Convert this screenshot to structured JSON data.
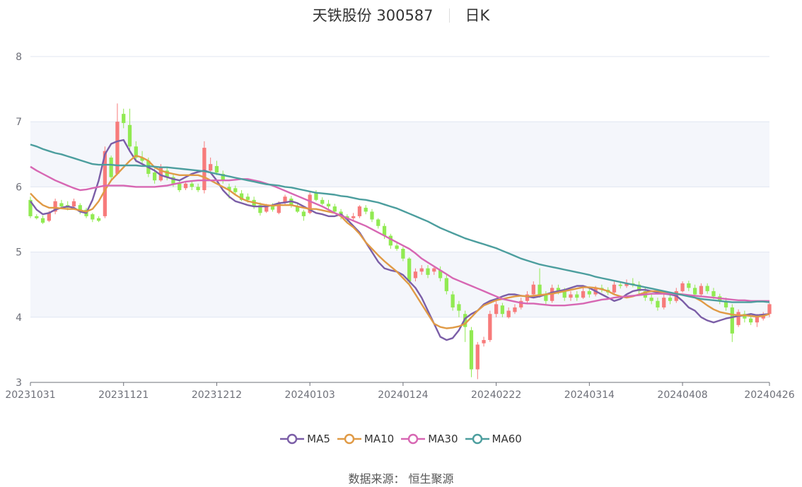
{
  "header": {
    "title": "天铁股份 300587",
    "period": "日K"
  },
  "footer": {
    "source_label": "数据来源：",
    "source_name": "恒生聚源"
  },
  "colors": {
    "up": "#f77b7b",
    "down": "#91ea52",
    "ma5": "#7b5ea7",
    "ma10": "#e09a45",
    "ma30": "#d767b3",
    "ma60": "#4c9e9e",
    "band": "#f4f6fb",
    "grid": "#e0e6f1"
  },
  "chart_data": {
    "type": "candlestick",
    "ylim": [
      3,
      8
    ],
    "yticks": [
      3,
      4,
      5,
      6,
      7,
      8
    ],
    "xtick_labels": [
      "20231031",
      "20231121",
      "20231212",
      "20240103",
      "20240124",
      "20240222",
      "20240314",
      "20240408",
      "20240426"
    ],
    "xtick_index": [
      0,
      15,
      30,
      45,
      60,
      75,
      90,
      105,
      119
    ],
    "grid": true,
    "legend_position": "bottom-center",
    "candles": [
      [
        5.8,
        5.55,
        5.85,
        5.52
      ],
      [
        5.55,
        5.52,
        5.58,
        5.5
      ],
      [
        5.52,
        5.45,
        5.56,
        5.43
      ],
      [
        5.48,
        5.6,
        5.63,
        5.46
      ],
      [
        5.62,
        5.78,
        5.82,
        5.58
      ],
      [
        5.75,
        5.7,
        5.8,
        5.66
      ],
      [
        5.72,
        5.68,
        5.78,
        5.64
      ],
      [
        5.7,
        5.78,
        5.82,
        5.67
      ],
      [
        5.72,
        5.62,
        5.75,
        5.58
      ],
      [
        5.65,
        5.55,
        5.68,
        5.52
      ],
      [
        5.58,
        5.5,
        5.6,
        5.46
      ],
      [
        5.52,
        5.48,
        5.55,
        5.46
      ],
      [
        5.55,
        6.55,
        6.62,
        5.52
      ],
      [
        6.45,
        6.15,
        6.48,
        6.1
      ],
      [
        6.2,
        7.0,
        7.28,
        6.18
      ],
      [
        7.12,
        6.98,
        7.2,
        6.9
      ],
      [
        6.95,
        6.62,
        7.2,
        6.55
      ],
      [
        6.62,
        6.45,
        6.7,
        6.38
      ],
      [
        6.45,
        6.4,
        6.55,
        6.35
      ],
      [
        6.4,
        6.2,
        6.45,
        6.15
      ],
      [
        6.22,
        6.1,
        6.28,
        6.05
      ],
      [
        6.1,
        6.3,
        6.35,
        6.08
      ],
      [
        6.25,
        6.15,
        6.3,
        6.1
      ],
      [
        6.15,
        6.05,
        6.2,
        6.0
      ],
      [
        6.05,
        5.95,
        6.1,
        5.92
      ],
      [
        5.98,
        6.05,
        6.08,
        5.95
      ],
      [
        6.05,
        6.0,
        6.1,
        5.95
      ],
      [
        6.0,
        5.95,
        6.05,
        5.92
      ],
      [
        5.95,
        6.6,
        6.7,
        5.9
      ],
      [
        6.25,
        6.35,
        6.45,
        6.2
      ],
      [
        6.32,
        6.22,
        6.4,
        6.18
      ],
      [
        6.2,
        6.1,
        6.25,
        6.05
      ],
      [
        6.0,
        5.95,
        6.05,
        5.82
      ],
      [
        5.98,
        5.92,
        6.02,
        5.88
      ],
      [
        5.9,
        5.8,
        5.95,
        5.78
      ],
      [
        5.85,
        5.8,
        5.9,
        5.76
      ],
      [
        5.8,
        5.7,
        5.85,
        5.66
      ],
      [
        5.72,
        5.6,
        5.76,
        5.56
      ],
      [
        5.62,
        5.7,
        5.74,
        5.6
      ],
      [
        5.7,
        5.65,
        5.75,
        5.62
      ],
      [
        5.6,
        5.75,
        5.78,
        5.58
      ],
      [
        5.75,
        5.85,
        5.88,
        5.72
      ],
      [
        5.82,
        5.72,
        5.86,
        5.68
      ],
      [
        5.7,
        5.62,
        5.74,
        5.6
      ],
      [
        5.62,
        5.55,
        5.65,
        5.48
      ],
      [
        5.6,
        5.88,
        5.92,
        5.58
      ],
      [
        5.9,
        5.8,
        5.95,
        5.78
      ],
      [
        5.8,
        5.74,
        5.84,
        5.72
      ],
      [
        5.74,
        5.7,
        5.8,
        5.66
      ],
      [
        5.7,
        5.62,
        5.74,
        5.6
      ],
      [
        5.62,
        5.55,
        5.66,
        5.5
      ],
      [
        5.55,
        5.5,
        5.58,
        5.44
      ],
      [
        5.52,
        5.55,
        5.6,
        5.48
      ],
      [
        5.55,
        5.7,
        5.72,
        5.52
      ],
      [
        5.68,
        5.62,
        5.72,
        5.58
      ],
      [
        5.62,
        5.5,
        5.66,
        5.46
      ],
      [
        5.5,
        5.4,
        5.52,
        5.36
      ],
      [
        5.4,
        5.25,
        5.44,
        5.2
      ],
      [
        5.25,
        5.1,
        5.28,
        5.05
      ],
      [
        5.1,
        5.05,
        5.14,
        5.02
      ],
      [
        5.05,
        4.9,
        5.08,
        4.86
      ],
      [
        4.9,
        4.55,
        4.92,
        4.5
      ],
      [
        4.6,
        4.7,
        4.75,
        4.55
      ],
      [
        4.7,
        4.75,
        4.8,
        4.65
      ],
      [
        4.75,
        4.65,
        4.8,
        4.6
      ],
      [
        4.7,
        4.75,
        4.78,
        4.65
      ],
      [
        4.72,
        4.6,
        4.78,
        4.55
      ],
      [
        4.6,
        4.4,
        4.65,
        4.35
      ],
      [
        4.35,
        4.15,
        4.4,
        4.1
      ],
      [
        4.2,
        4.1,
        4.25,
        4.0
      ],
      [
        4.05,
        3.85,
        4.1,
        3.62
      ],
      [
        3.8,
        3.2,
        3.85,
        3.08
      ],
      [
        3.2,
        3.58,
        3.62,
        3.05
      ],
      [
        3.6,
        3.65,
        3.7,
        3.55
      ],
      [
        3.65,
        4.05,
        4.1,
        3.62
      ],
      [
        4.05,
        4.2,
        4.25,
        4.0
      ],
      [
        4.18,
        4.05,
        4.22,
        4.0
      ],
      [
        4.0,
        4.1,
        4.15,
        3.98
      ],
      [
        4.08,
        4.15,
        4.2,
        4.05
      ],
      [
        4.15,
        4.25,
        4.3,
        4.12
      ],
      [
        4.25,
        4.35,
        4.4,
        4.2
      ],
      [
        4.35,
        4.5,
        4.55,
        4.3
      ],
      [
        4.5,
        4.35,
        4.75,
        4.3
      ],
      [
        4.35,
        4.25,
        4.4,
        4.2
      ],
      [
        4.25,
        4.45,
        4.5,
        4.22
      ],
      [
        4.45,
        4.4,
        4.5,
        4.35
      ],
      [
        4.4,
        4.3,
        4.45,
        4.25
      ],
      [
        4.3,
        4.35,
        4.4,
        4.25
      ],
      [
        4.35,
        4.3,
        4.4,
        4.25
      ],
      [
        4.3,
        4.4,
        4.45,
        4.28
      ],
      [
        4.4,
        4.35,
        4.45,
        4.3
      ],
      [
        4.35,
        4.45,
        4.48,
        4.32
      ],
      [
        4.45,
        4.42,
        4.5,
        4.38
      ],
      [
        4.42,
        4.38,
        4.46,
        4.34
      ],
      [
        4.38,
        4.5,
        4.55,
        4.36
      ],
      [
        4.5,
        4.48,
        4.55,
        4.44
      ],
      [
        4.48,
        4.52,
        4.58,
        4.45
      ],
      [
        4.52,
        4.5,
        4.6,
        4.46
      ],
      [
        4.5,
        4.4,
        4.55,
        4.36
      ],
      [
        4.4,
        4.3,
        4.45,
        4.25
      ],
      [
        4.3,
        4.25,
        4.35,
        4.2
      ],
      [
        4.25,
        4.15,
        4.3,
        4.1
      ],
      [
        4.15,
        4.3,
        4.35,
        4.12
      ],
      [
        4.3,
        4.25,
        4.35,
        4.2
      ],
      [
        4.25,
        4.4,
        4.45,
        4.22
      ],
      [
        4.4,
        4.52,
        4.55,
        4.38
      ],
      [
        4.52,
        4.45,
        4.56,
        4.4
      ],
      [
        4.45,
        4.35,
        4.5,
        4.3
      ],
      [
        4.35,
        4.48,
        4.52,
        4.32
      ],
      [
        4.48,
        4.4,
        4.52,
        4.36
      ],
      [
        4.4,
        4.32,
        4.45,
        4.28
      ],
      [
        4.32,
        4.25,
        4.36,
        4.2
      ],
      [
        4.25,
        4.15,
        4.3,
        4.1
      ],
      [
        4.15,
        3.75,
        4.2,
        3.62
      ],
      [
        3.88,
        4.08,
        4.12,
        3.85
      ],
      [
        4.05,
        3.98,
        4.1,
        3.92
      ],
      [
        3.98,
        3.92,
        4.02,
        3.88
      ],
      [
        3.92,
        4.0,
        4.05,
        3.85
      ],
      [
        3.98,
        4.05,
        4.08,
        3.95
      ],
      [
        4.05,
        4.2,
        4.22,
        4.0
      ]
    ],
    "series": [
      {
        "name": "MA5",
        "values": [
          5.78,
          5.65,
          5.58,
          5.6,
          5.65,
          5.68,
          5.7,
          5.68,
          5.62,
          5.6,
          5.8,
          6.1,
          6.5,
          6.66,
          6.7,
          6.72,
          6.55,
          6.4,
          6.35,
          6.3,
          6.25,
          6.18,
          6.15,
          6.12,
          6.1,
          6.15,
          6.2,
          6.23,
          6.25,
          6.22,
          6.1,
          5.95,
          5.85,
          5.78,
          5.75,
          5.72,
          5.7,
          5.7,
          5.7,
          5.72,
          5.75,
          5.76,
          5.78,
          5.75,
          5.7,
          5.65,
          5.6,
          5.58,
          5.55,
          5.55,
          5.58,
          5.5,
          5.4,
          5.3,
          5.15,
          5.0,
          4.85,
          4.75,
          4.72,
          4.7,
          4.65,
          4.55,
          4.45,
          4.3,
          4.1,
          3.9,
          3.7,
          3.65,
          3.68,
          3.8,
          3.98,
          4.05,
          4.1,
          4.2,
          4.25,
          4.28,
          4.32,
          4.35,
          4.35,
          4.33,
          4.32,
          4.3,
          4.32,
          4.35,
          4.38,
          4.4,
          4.42,
          4.45,
          4.48,
          4.48,
          4.45,
          4.4,
          4.35,
          4.3,
          4.25,
          4.28,
          4.35,
          4.4,
          4.42,
          4.42,
          4.4,
          4.38,
          4.36,
          4.35,
          4.33,
          4.25,
          4.15,
          4.1,
          4.0,
          3.95,
          3.92,
          3.95,
          3.98,
          4.0,
          4.02,
          4.03,
          4.05,
          4.03,
          4.04,
          4.05
        ]
      },
      {
        "name": "MA10",
        "values": [
          5.9,
          5.8,
          5.72,
          5.68,
          5.68,
          5.67,
          5.66,
          5.66,
          5.64,
          5.62,
          5.66,
          5.78,
          5.95,
          6.1,
          6.2,
          6.3,
          6.4,
          6.48,
          6.45,
          6.4,
          6.3,
          6.25,
          6.22,
          6.2,
          6.18,
          6.18,
          6.18,
          6.18,
          6.15,
          6.1,
          6.05,
          6.0,
          5.95,
          5.88,
          5.82,
          5.78,
          5.76,
          5.74,
          5.72,
          5.71,
          5.72,
          5.72,
          5.72,
          5.7,
          5.68,
          5.66,
          5.66,
          5.64,
          5.62,
          5.6,
          5.55,
          5.45,
          5.38,
          5.28,
          5.15,
          5.05,
          4.95,
          4.86,
          4.78,
          4.7,
          4.6,
          4.5,
          4.35,
          4.2,
          4.05,
          3.9,
          3.85,
          3.83,
          3.84,
          3.86,
          3.9,
          4.0,
          4.1,
          4.18,
          4.22,
          4.26,
          4.28,
          4.3,
          4.32,
          4.33,
          4.32,
          4.33,
          4.34,
          4.35,
          4.36,
          4.38,
          4.4,
          4.42,
          4.44,
          4.46,
          4.46,
          4.45,
          4.43,
          4.4,
          4.35,
          4.32,
          4.3,
          4.32,
          4.35,
          4.38,
          4.4,
          4.4,
          4.38,
          4.37,
          4.36,
          4.35,
          4.33,
          4.3,
          4.25,
          4.18,
          4.12,
          4.08,
          4.06,
          4.04,
          4.03,
          4.03,
          4.02,
          4.01,
          4.02,
          4.05
        ]
      },
      {
        "name": "MA30",
        "values": [
          6.31,
          6.25,
          6.2,
          6.15,
          6.1,
          6.06,
          6.02,
          5.98,
          5.95,
          5.96,
          5.98,
          6.0,
          6.02,
          6.02,
          6.02,
          6.02,
          6.01,
          6.0,
          6.0,
          6.0,
          6.0,
          6.01,
          6.02,
          6.04,
          6.06,
          6.08,
          6.09,
          6.1,
          6.1,
          6.1,
          6.1,
          6.1,
          6.1,
          6.11,
          6.12,
          6.12,
          6.1,
          6.08,
          6.05,
          6.02,
          5.98,
          5.94,
          5.9,
          5.86,
          5.82,
          5.78,
          5.74,
          5.7,
          5.65,
          5.6,
          5.56,
          5.52,
          5.48,
          5.44,
          5.4,
          5.35,
          5.3,
          5.25,
          5.2,
          5.15,
          5.1,
          5.05,
          4.98,
          4.9,
          4.84,
          4.78,
          4.72,
          4.66,
          4.6,
          4.56,
          4.52,
          4.48,
          4.44,
          4.4,
          4.36,
          4.32,
          4.28,
          4.26,
          4.24,
          4.22,
          4.21,
          4.21,
          4.2,
          4.19,
          4.18,
          4.18,
          4.18,
          4.19,
          4.2,
          4.21,
          4.23,
          4.25,
          4.27,
          4.28,
          4.3,
          4.31,
          4.32,
          4.33,
          4.34,
          4.35,
          4.36,
          4.36,
          4.36,
          4.36,
          4.35,
          4.35,
          4.34,
          4.33,
          4.32,
          4.31,
          4.3,
          4.29,
          4.28,
          4.27,
          4.26,
          4.26,
          4.25,
          4.25,
          4.25,
          4.25
        ]
      },
      {
        "name": "MA60",
        "values": [
          6.65,
          6.62,
          6.58,
          6.55,
          6.52,
          6.5,
          6.47,
          6.44,
          6.41,
          6.38,
          6.35,
          6.34,
          6.34,
          6.34,
          6.33,
          6.33,
          6.33,
          6.33,
          6.32,
          6.32,
          6.31,
          6.3,
          6.3,
          6.29,
          6.28,
          6.27,
          6.26,
          6.25,
          6.24,
          6.22,
          6.2,
          6.18,
          6.16,
          6.14,
          6.12,
          6.1,
          6.08,
          6.06,
          6.04,
          6.03,
          6.02,
          6.0,
          5.99,
          5.97,
          5.95,
          5.93,
          5.91,
          5.9,
          5.89,
          5.88,
          5.86,
          5.85,
          5.83,
          5.81,
          5.8,
          5.78,
          5.76,
          5.73,
          5.7,
          5.67,
          5.63,
          5.59,
          5.55,
          5.51,
          5.47,
          5.42,
          5.37,
          5.33,
          5.29,
          5.25,
          5.21,
          5.18,
          5.15,
          5.12,
          5.09,
          5.06,
          5.02,
          4.98,
          4.94,
          4.9,
          4.87,
          4.84,
          4.81,
          4.79,
          4.77,
          4.75,
          4.73,
          4.71,
          4.69,
          4.67,
          4.65,
          4.62,
          4.6,
          4.58,
          4.56,
          4.54,
          4.52,
          4.5,
          4.48,
          4.46,
          4.44,
          4.42,
          4.4,
          4.38,
          4.36,
          4.34,
          4.32,
          4.3,
          4.28,
          4.27,
          4.26,
          4.25,
          4.24,
          4.23,
          4.23,
          4.23,
          4.23,
          4.24,
          4.24,
          4.23
        ]
      }
    ]
  }
}
